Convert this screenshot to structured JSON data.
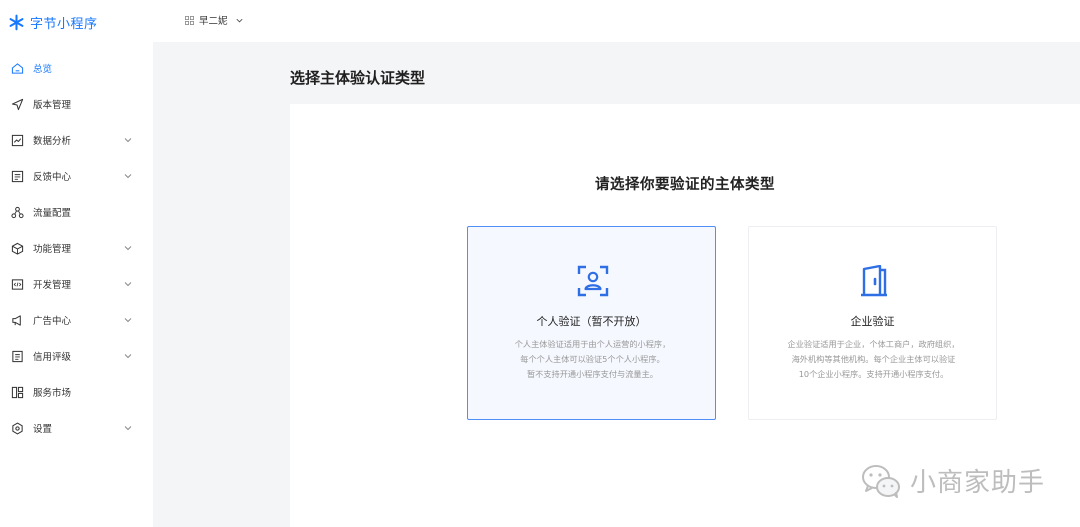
{
  "brand": {
    "name": "字节小程序",
    "color": "#1677ff"
  },
  "topbar": {
    "app_name": "早二妮"
  },
  "sidebar": {
    "items": [
      {
        "label": "总览",
        "icon": "home-icon",
        "active": true,
        "expandable": false
      },
      {
        "label": "版本管理",
        "icon": "send-icon",
        "active": false,
        "expandable": false
      },
      {
        "label": "数据分析",
        "icon": "chart-icon",
        "active": false,
        "expandable": true
      },
      {
        "label": "反馈中心",
        "icon": "message-icon",
        "active": false,
        "expandable": true
      },
      {
        "label": "流量配置",
        "icon": "network-icon",
        "active": false,
        "expandable": false
      },
      {
        "label": "功能管理",
        "icon": "cube-icon",
        "active": false,
        "expandable": true
      },
      {
        "label": "开发管理",
        "icon": "code-icon",
        "active": false,
        "expandable": true
      },
      {
        "label": "广告中心",
        "icon": "megaphone-icon",
        "active": false,
        "expandable": true
      },
      {
        "label": "信用评级",
        "icon": "document-icon",
        "active": false,
        "expandable": true
      },
      {
        "label": "服务市场",
        "icon": "layout-icon",
        "active": false,
        "expandable": false
      },
      {
        "label": "设置",
        "icon": "settings-icon",
        "active": false,
        "expandable": true
      }
    ]
  },
  "main": {
    "title": "选择主体验认证类型",
    "heading": "请选择你要验证的主体类型",
    "cards": {
      "personal": {
        "title": "个人验证（暂不开放）",
        "desc_lines": [
          "个人主体验证适用于由个人运营的小程序，",
          "每个个人主体可以验证5个个人小程序。",
          "暂不支持开通小程序支付与流量主。"
        ],
        "icon": "face-scan-icon"
      },
      "enterprise": {
        "title": "企业验证",
        "desc_lines": [
          "企业验证适用于企业，个体工商户，政府组织，",
          "海外机构等其他机构。每个企业主体可以验证",
          "10个企业小程序。支持开通小程序支付。"
        ],
        "icon": "door-icon"
      }
    }
  },
  "watermark": {
    "text": "小商家助手",
    "icon": "wechat-icon"
  },
  "colors": {
    "accent": "#1677ff",
    "selected_border": "#4f8ff7",
    "icon_blue": "#2f6fe6"
  }
}
